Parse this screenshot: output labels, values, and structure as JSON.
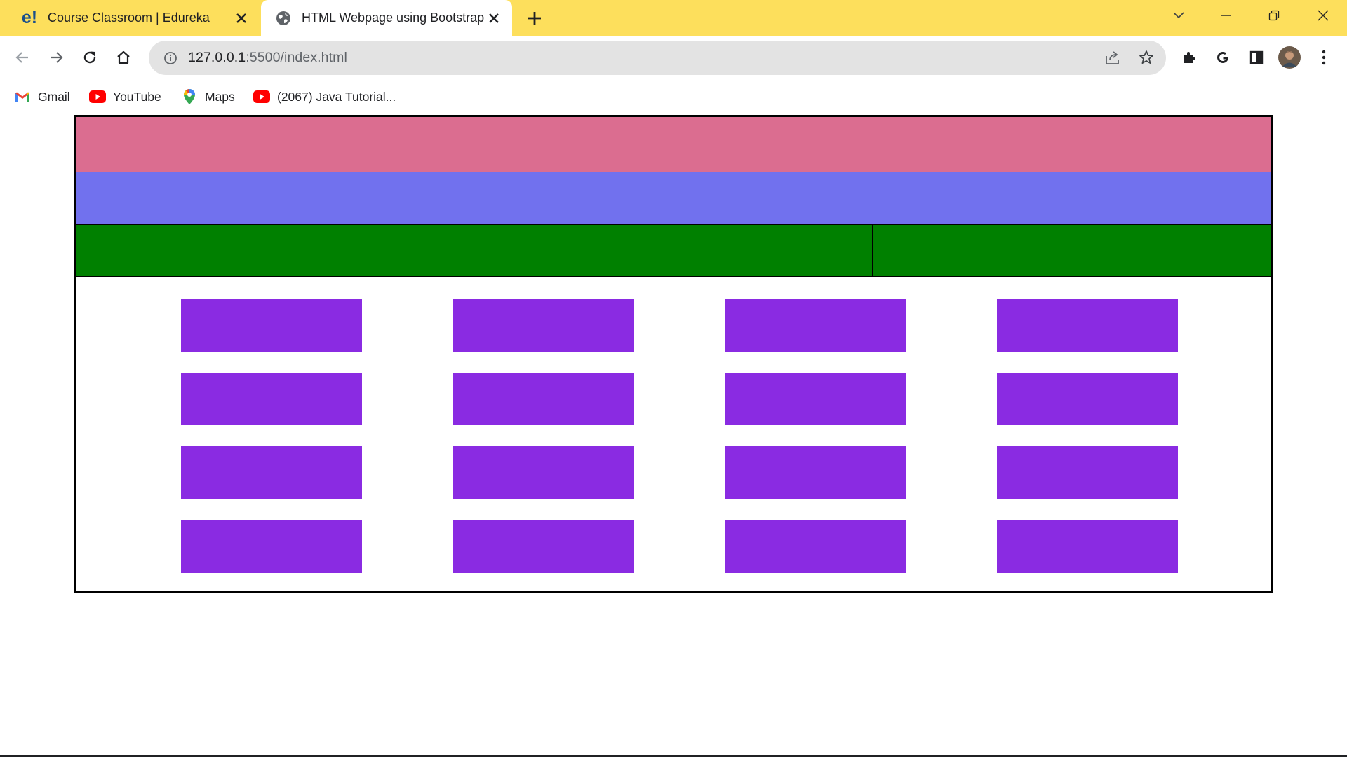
{
  "browser": {
    "tabs": [
      {
        "title": "Course Classroom | Edureka",
        "favicon": "edureka-logo",
        "active": false
      },
      {
        "title": "HTML Webpage using Bootstrap",
        "favicon": "globe-icon",
        "active": true
      }
    ],
    "favicon_text": "e!",
    "address": {
      "host": "127.0.0.1",
      "path": ":5500/index.html"
    },
    "bookmarks": [
      {
        "label": "Gmail",
        "icon": "gmail-icon"
      },
      {
        "label": "YouTube",
        "icon": "youtube-icon"
      },
      {
        "label": "Maps",
        "icon": "maps-icon"
      },
      {
        "label": "(2067) Java Tutorial...",
        "icon": "youtube-icon"
      }
    ],
    "colors": {
      "tabstrip": "#fddf5c",
      "omnibox": "#e3e3e3"
    }
  },
  "page": {
    "colors": {
      "header_row": "#db6d90",
      "two_column_row": "#7171ee",
      "three_column_row": "#008000",
      "grid_box": "#8a2be2",
      "border": "#000000"
    },
    "grid": {
      "rows": 4,
      "columns": 4
    }
  }
}
